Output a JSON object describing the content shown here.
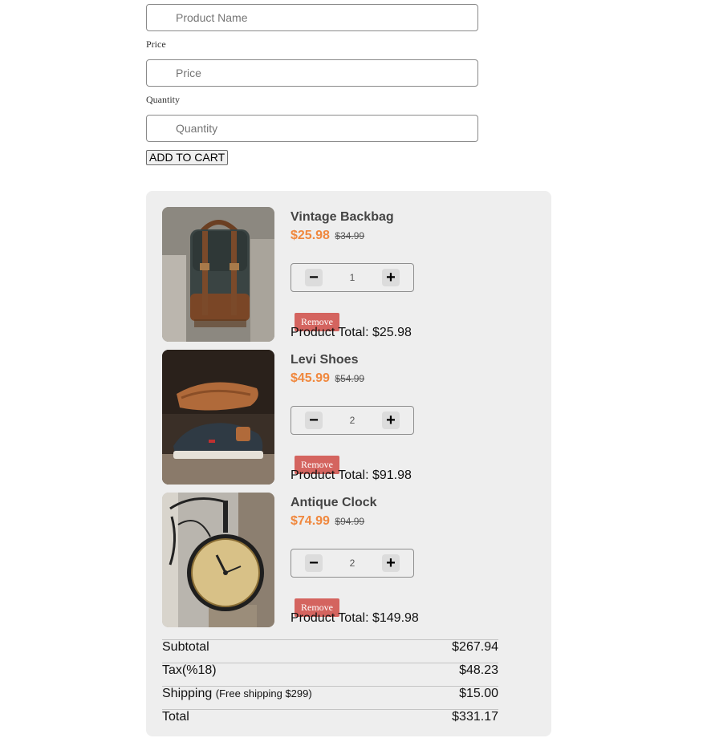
{
  "form": {
    "product_name": {
      "placeholder": "Product Name"
    },
    "price": {
      "label": "Price",
      "placeholder": "Price"
    },
    "quantity": {
      "label": "Quantity",
      "placeholder": "Quantity"
    },
    "add_button": "ADD TO CART"
  },
  "cart": {
    "items": [
      {
        "name": "Vintage Backbag",
        "price": "$25.98",
        "old_price": "$34.99",
        "quantity": "1",
        "remove_label": "Remove",
        "total": "Product Total: $25.98",
        "image": "leather-backpack-photo"
      },
      {
        "name": "Levi Shoes",
        "price": "$45.99",
        "old_price": "$54.99",
        "quantity": "2",
        "remove_label": "Remove",
        "total": "Product Total: $91.98",
        "image": "canvas-sneakers-photo"
      },
      {
        "name": "Antique Clock",
        "price": "$74.99",
        "old_price": "$94.99",
        "quantity": "2",
        "remove_label": "Remove",
        "total": "Product Total: $149.98",
        "image": "station-clock-photo"
      }
    ],
    "stepper": {
      "minus": "−",
      "plus": "+"
    },
    "summary": {
      "subtotal": {
        "label": "Subtotal",
        "value": "$267.94"
      },
      "tax": {
        "label": "Tax(%18)",
        "value": "$48.23"
      },
      "shipping": {
        "label": "Shipping",
        "note": "(Free shipping $299)",
        "value": "$15.00"
      },
      "total": {
        "label": "Total",
        "value": "$331.17"
      }
    }
  },
  "colors": {
    "price_accent": "#f0883e",
    "remove_button": "#d4645f",
    "panel_background": "#eeeeee"
  }
}
